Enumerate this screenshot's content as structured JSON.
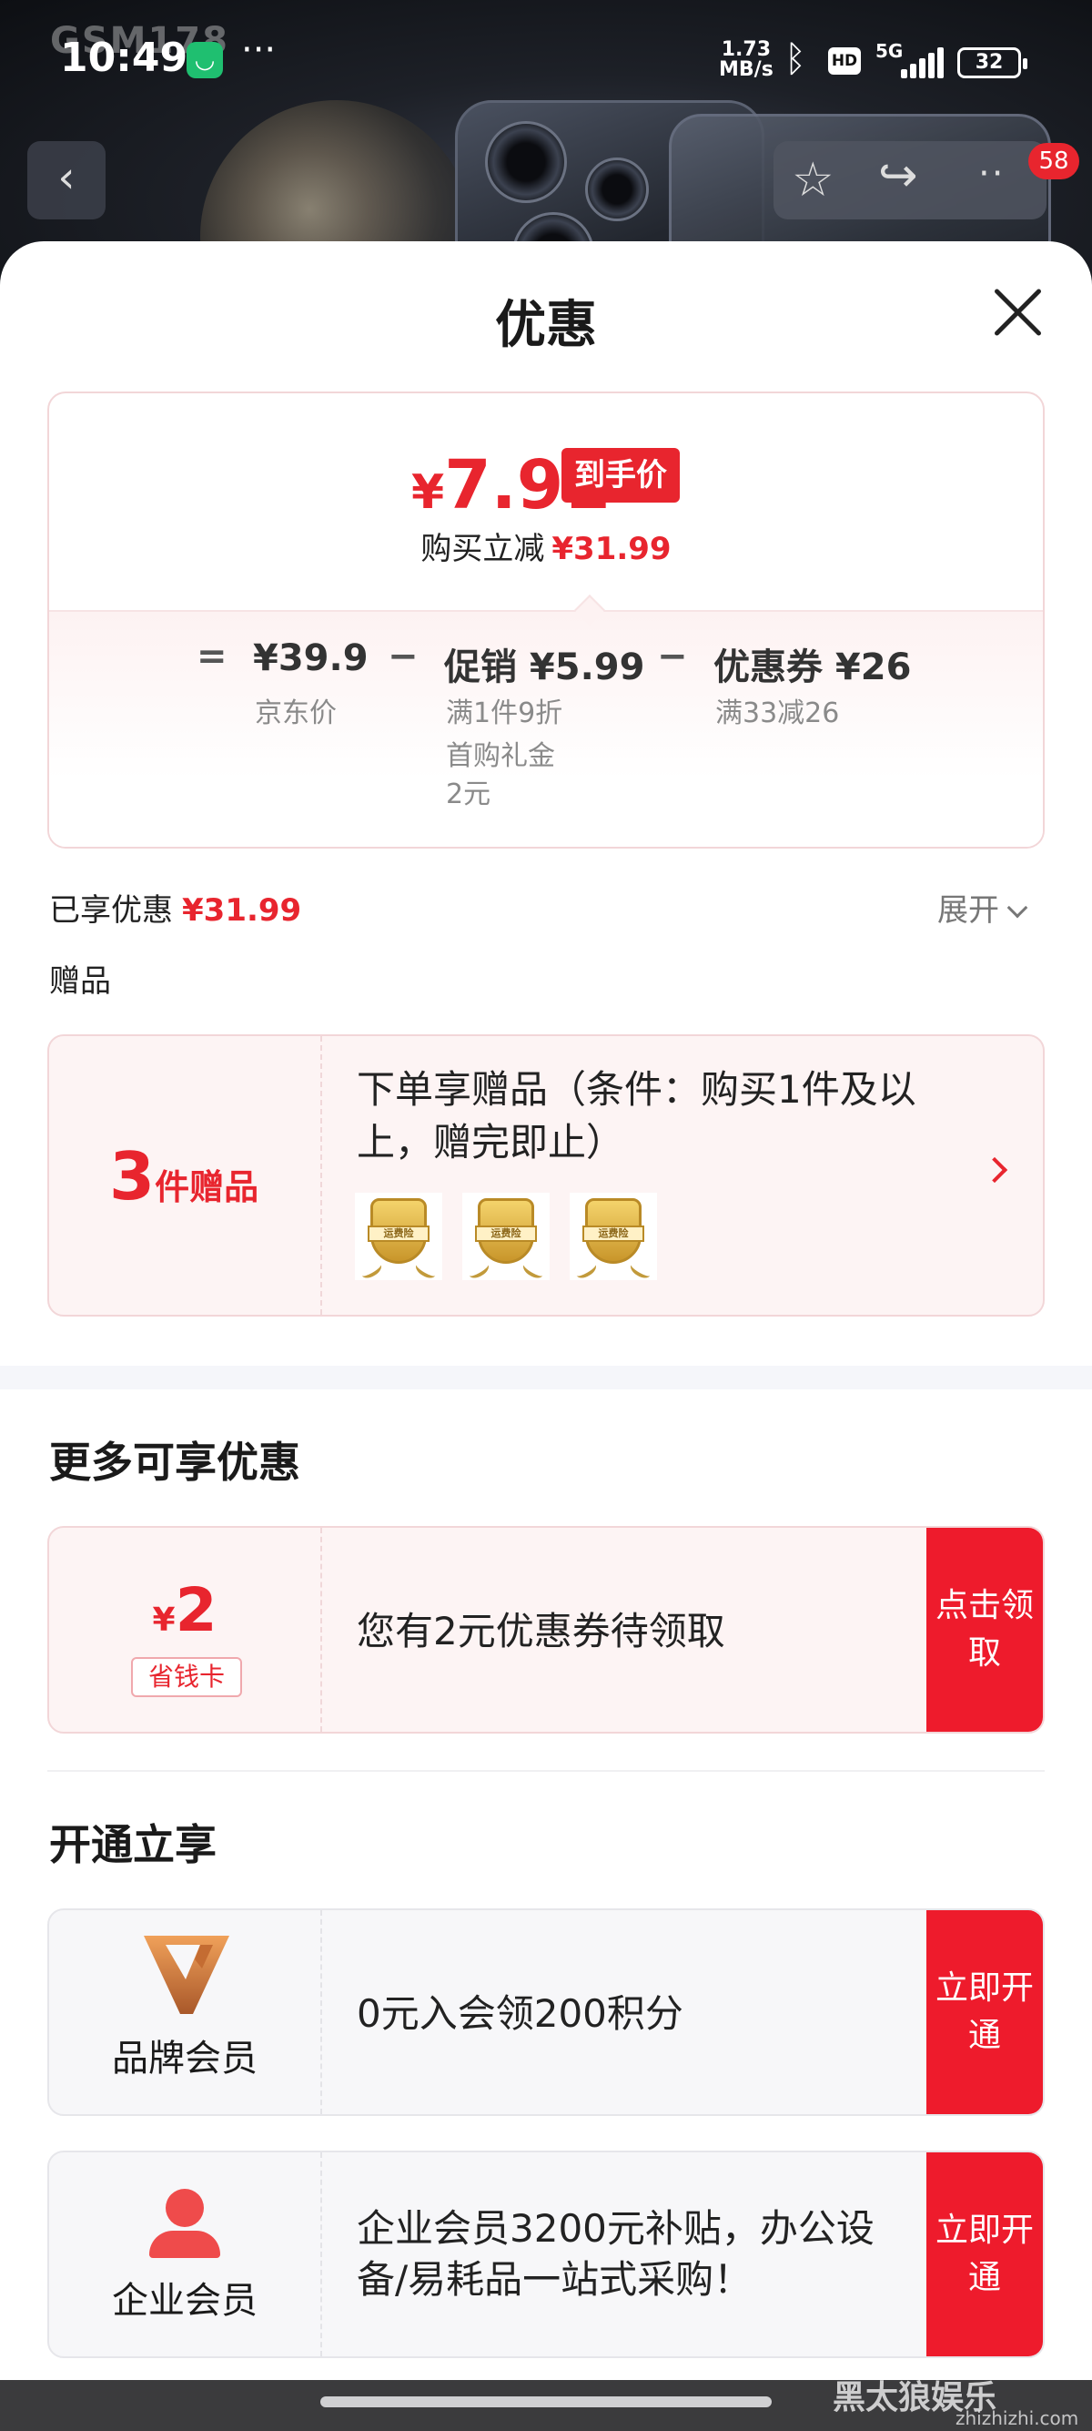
{
  "status_bar": {
    "time": "10:49",
    "more": "···",
    "net_speed_value": "1.73",
    "net_speed_unit": "MB/s",
    "hd": "HD",
    "network": "5G",
    "battery": "32"
  },
  "watermark_top": "GSM178",
  "nav": {
    "back_icon": "‹",
    "badge": "58"
  },
  "sheet": {
    "title": "优惠"
  },
  "price_card": {
    "currency": "¥",
    "final_price": "7.91",
    "final_tag": "到手价",
    "reduce_label": "购买立减",
    "reduce_amount": "¥31.99",
    "eq": "=",
    "minus": "−",
    "jd_price": "¥39.9",
    "jd_label": "京东价",
    "promo": "促销 ¥5.99",
    "promo_note_1": "满1件9折",
    "promo_note_2": "首购礼金",
    "promo_note_3": "2元",
    "coupon": "优惠券 ¥26",
    "coupon_note": "满33减26"
  },
  "enjoyed": {
    "label": "已享优惠",
    "amount": "¥31.99",
    "expand": "展开"
  },
  "gifts": {
    "section": "赠品",
    "count": "3",
    "count_unit": "件赠品",
    "desc": "下单享赠品（条件：购买1件及以上，赠完即止）",
    "medal_text": "运费险"
  },
  "more_offers": {
    "title": "更多可享优惠",
    "coupon_currency": "¥",
    "coupon_value": "2",
    "coupon_tag": "省钱卡",
    "coupon_text": "您有2元优惠券待领取",
    "claim_button": "点击领取"
  },
  "open_enjoy": {
    "title": "开通立享",
    "brand_member": "品牌会员",
    "brand_text": "0元入会领200积分",
    "brand_button": "立即开通",
    "enterprise_member": "企业会员",
    "enterprise_text": "企业会员3200元补贴，办公设备/易耗品一站式采购！",
    "enterprise_button": "立即开通"
  },
  "watermark_bottom": {
    "text": "黑太狼娱乐",
    "url": "zhizhizhi.com"
  },
  "colors": {
    "accent": "#e8252e",
    "button_red": "#ee1b2c",
    "card_pink": "#fdf4f4"
  },
  "icons": [
    "back-icon",
    "star-icon",
    "share-icon",
    "more-icon",
    "close-icon",
    "chevron-down-icon",
    "chevron-right-icon",
    "medal-icon",
    "brand-v-logo-icon",
    "person-icon"
  ]
}
